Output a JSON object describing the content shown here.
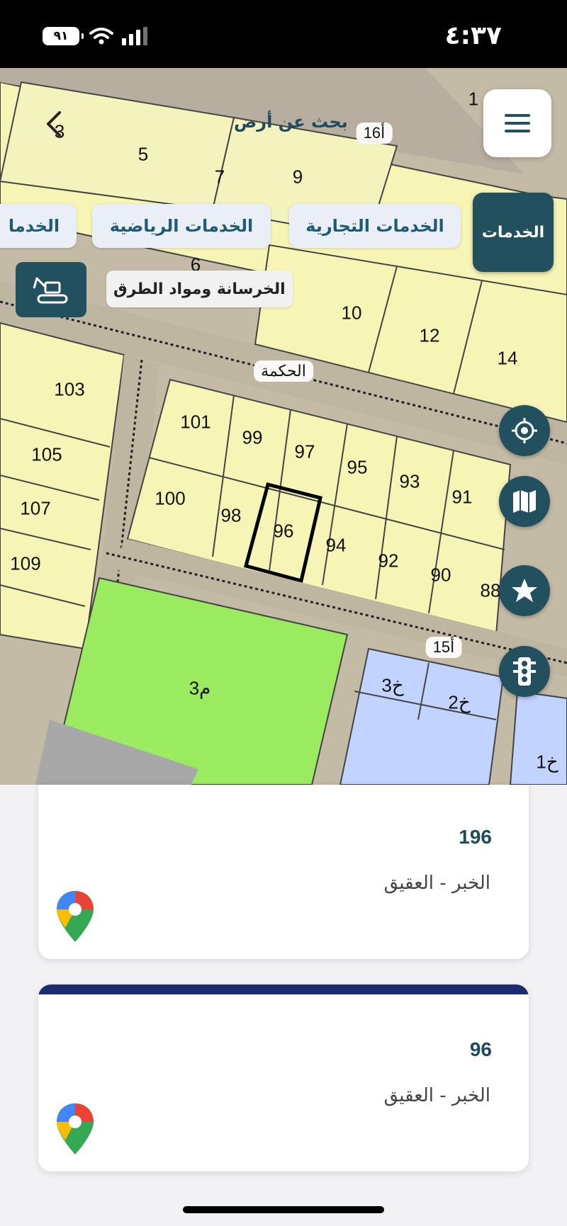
{
  "status_bar": {
    "battery": "٩١",
    "time": "٤:٣٧"
  },
  "header": {
    "title": "بحث عن أرض"
  },
  "chips": {
    "active": "الخدمات",
    "commercial": "الخدمات التجارية",
    "sports": "الخدمات الرياضية",
    "partial": "الخدما"
  },
  "tool": {
    "label": "الخرسانة ومواد الطرق",
    "icon": "excavator-icon"
  },
  "fabs": [
    "locate-icon",
    "map-icon",
    "star-icon",
    "traffic-light-icon"
  ],
  "map": {
    "plots": [
      "1",
      "3",
      "5",
      "7",
      "9",
      "6",
      "10",
      "12",
      "14",
      "103",
      "105",
      "107",
      "109",
      "101",
      "99",
      "97",
      "95",
      "93",
      "91",
      "100",
      "98",
      "96",
      "94",
      "92",
      "90",
      "88",
      "م3",
      "خ3",
      "خ2",
      "خ1"
    ],
    "streets": [
      "16أ",
      "الحكمة",
      "15أ"
    ],
    "selected_plot": "96"
  },
  "cards": [
    {
      "number": "196",
      "location": "الخبر - العقيق"
    },
    {
      "number": "96",
      "location": "الخبر - العقيق"
    }
  ],
  "colors": {
    "primary": "#23505f",
    "plot_yellow": "#f7f5b5",
    "park_green": "#9aeb5f",
    "services_blue": "#c3d3ff",
    "card_topbar": "#1d2a6b"
  }
}
